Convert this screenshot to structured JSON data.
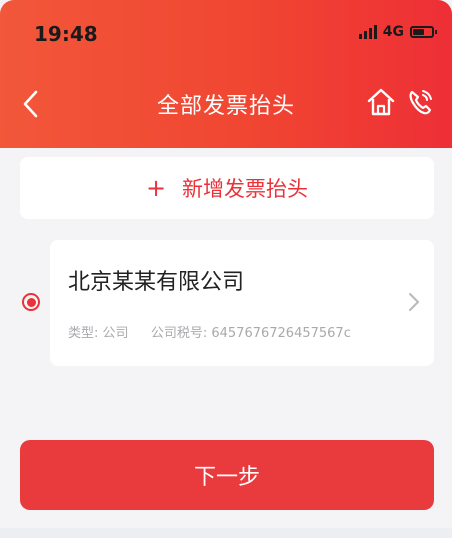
{
  "status_bar": {
    "time": "19:48",
    "network": "4G",
    "signal_icon": "signal-bars-icon",
    "battery_icon": "battery-icon",
    "battery_level": 0.6
  },
  "nav": {
    "title": "全部发票抬头",
    "back_icon": "chevron-left-icon",
    "home_icon": "home-icon",
    "phone_icon": "phone-icon"
  },
  "add_header": {
    "plus": "+",
    "label": "新增发票抬头"
  },
  "invoice_headers": [
    {
      "name": "北京某某有限公司",
      "type_label": "类型:",
      "type_value": "公司",
      "tax_label": "公司税号:",
      "tax_value": "6457676726457567c",
      "selected": true
    }
  ],
  "next_button": {
    "label": "下一步"
  },
  "colors": {
    "accent": "#e9323a",
    "header_gradient_start": "#f2573a",
    "header_gradient_end": "#ee2f36",
    "background": "#f4f4f6"
  }
}
